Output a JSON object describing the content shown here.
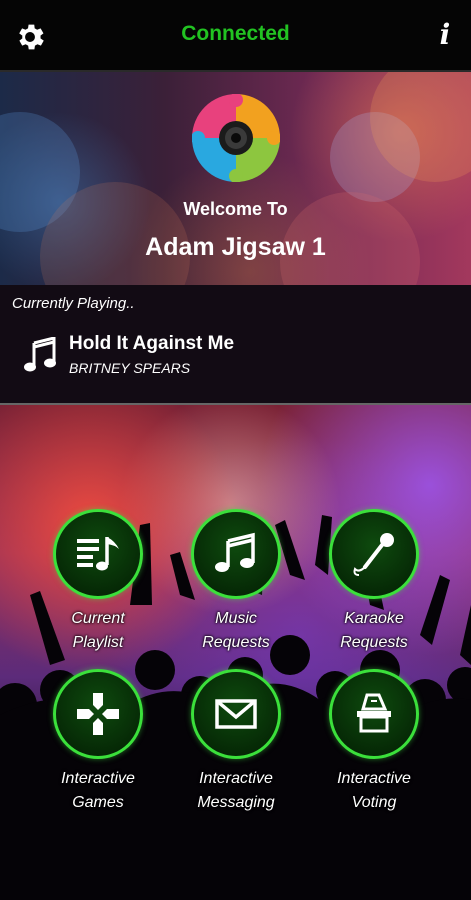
{
  "topbar": {
    "status": "Connected",
    "status_color": "#22c322",
    "info_glyph": "i"
  },
  "header": {
    "welcome": "Welcome To",
    "venue": "Adam Jigsaw 1"
  },
  "now_playing": {
    "label": "Currently Playing..",
    "title": "Hold It Against Me",
    "artist": "BRITNEY SPEARS"
  },
  "menu": {
    "items": [
      {
        "line1": "Current",
        "line2": "Playlist",
        "icon": "playlist-icon"
      },
      {
        "line1": "Music",
        "line2": "Requests",
        "icon": "music-note-icon"
      },
      {
        "line1": "Karaoke",
        "line2": "Requests",
        "icon": "microphone-icon"
      },
      {
        "line1": "Interactive",
        "line2": "Games",
        "icon": "gamepad-icon"
      },
      {
        "line1": "Interactive",
        "line2": "Messaging",
        "icon": "envelope-icon"
      },
      {
        "line1": "Interactive",
        "line2": "Voting",
        "icon": "ballot-box-icon"
      }
    ],
    "accent_color": "#3be03b"
  }
}
